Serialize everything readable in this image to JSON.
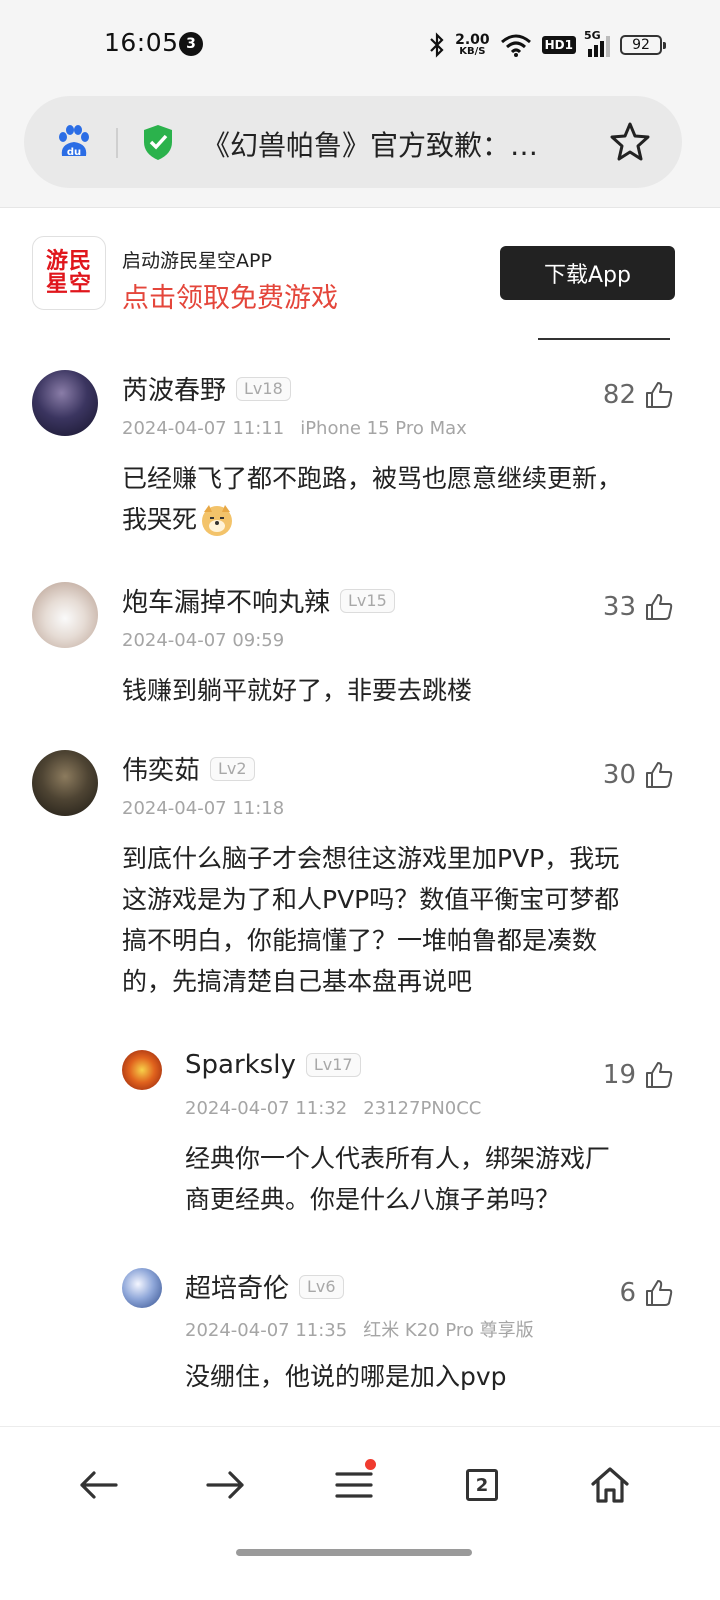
{
  "status_bar": {
    "time": "16:05",
    "notification_count": "3",
    "net_speed_value": "2.00",
    "net_speed_unit": "KB/S",
    "hd_label": "HD1",
    "signal_label": "5G",
    "battery": "92"
  },
  "address_bar": {
    "title": "《幻兽帕鲁》官方致歉：…",
    "icons": [
      "baidu-paw-icon",
      "shield-check-icon",
      "star-icon"
    ],
    "shield_color": "#2bb24c"
  },
  "ad": {
    "logo_text": "游民星空",
    "line1": "启动游民星空APP",
    "line2": "点击领取免费游戏",
    "button_label": "下载App",
    "accent_color": "#e4463b"
  },
  "comments": [
    {
      "username": "芮波春野",
      "level": "Lv18",
      "date": "2024-04-07 11:11",
      "device": "iPhone 15 Pro Max",
      "likes": "82",
      "body_line1": "已经赚飞了都不跑路，被骂也愿意继续更新，",
      "body_line2": "我哭死",
      "emoji": "doge-emoji"
    },
    {
      "username": "炮车漏掉不响丸辣",
      "level": "Lv15",
      "date": "2024-04-07 09:59",
      "device": "",
      "likes": "33",
      "body_line1": "钱赚到躺平就好了，非要去跳楼"
    },
    {
      "username": "伟奕茹",
      "level": "Lv2",
      "date": "2024-04-07 11:18",
      "device": "",
      "likes": "30",
      "body_line1": "到底什么脑子才会想往这游戏里加PVP，我玩",
      "body_line2": "这游戏是为了和人PVP吗？数值平衡宝可梦都",
      "body_line3": "搞不明白，你能搞懂了？一堆帕鲁都是凑数",
      "body_line4": "的，先搞清楚自己基本盘再说吧"
    }
  ],
  "replies": [
    {
      "username": "Sparksly",
      "level": "Lv17",
      "date": "2024-04-07 11:32",
      "device": "23127PN0CC",
      "likes": "19",
      "body_line1": "经典你一个人代表所有人，绑架游戏厂",
      "body_line2": "商更经典。你是什么八旗子弟吗？"
    },
    {
      "username": "超培奇伦",
      "level": "Lv6",
      "date": "2024-04-07 11:35",
      "device": "红米 K20 Pro 尊享版",
      "likes": "6",
      "body_line1": "没绷住，他说的哪是加入pvp"
    }
  ],
  "bottom_nav": {
    "items": [
      "back-arrow-icon",
      "forward-arrow-icon",
      "menu-icon",
      "tabs-icon",
      "home-icon"
    ],
    "tab_count": "2",
    "badge_color": "#f03b2f"
  }
}
